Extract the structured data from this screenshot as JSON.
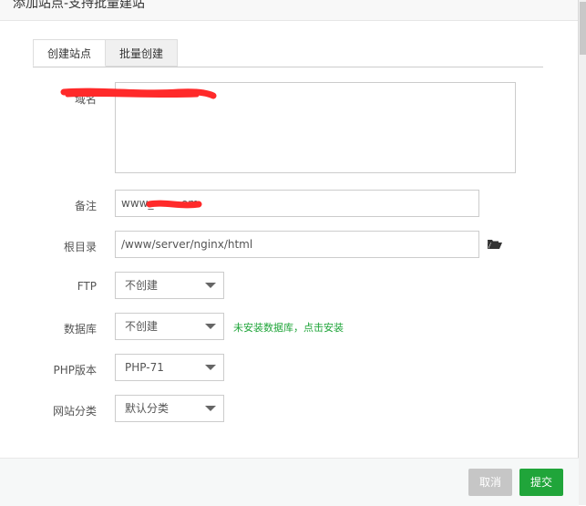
{
  "dialog": {
    "title": "添加站点-支持批量建站"
  },
  "tabs": {
    "create_site": "创建站点",
    "batch_create": "批量创建"
  },
  "form": {
    "domain": {
      "label": "域名",
      "value": ""
    },
    "remark": {
      "label": "备注",
      "value": "www_        om"
    },
    "root_dir": {
      "label": "根目录",
      "value": "/www/server/nginx/html"
    },
    "ftp": {
      "label": "FTP",
      "selected": "不创建"
    },
    "database": {
      "label": "数据库",
      "selected": "不创建",
      "hint": "未安装数据库，点击安装"
    },
    "php_version": {
      "label": "PHP版本",
      "selected": "PHP-71"
    },
    "site_category": {
      "label": "网站分类",
      "selected": "默认分类"
    }
  },
  "buttons": {
    "cancel": "取消",
    "submit": "提交"
  },
  "icons": {
    "folder": "folder-open-icon",
    "dropdown": "chevron-down-icon"
  },
  "colors": {
    "accent": "#20a53a",
    "cancel": "#c6c6c6",
    "redaction": "#ff2a2a"
  }
}
